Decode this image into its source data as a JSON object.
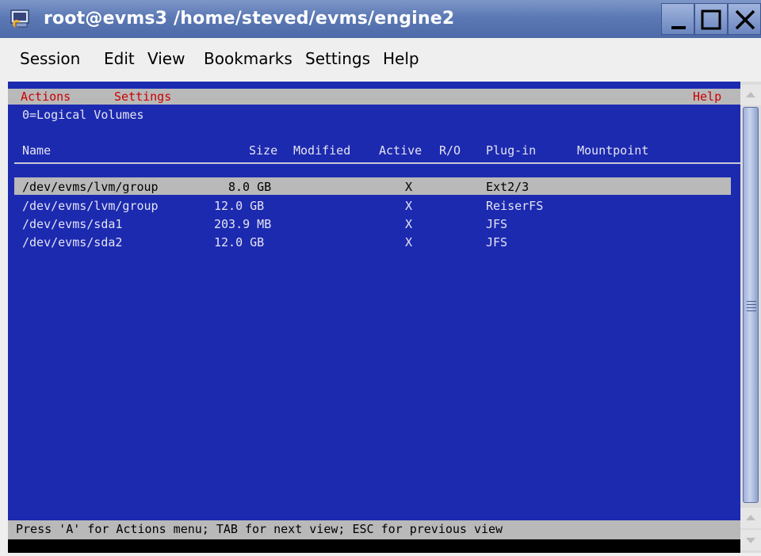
{
  "window": {
    "title": "root@evms3 /home/steved/evms/engine2"
  },
  "konsole_menu": [
    "Session",
    "Edit",
    "View",
    "Bookmarks",
    "Settings",
    "Help"
  ],
  "evms": {
    "menu": {
      "actions": "Actions",
      "settings": "Settings",
      "help": "Help"
    },
    "view_title": "0=Logical Volumes",
    "columns": {
      "name": "Name",
      "size": "Size",
      "modified": "Modified",
      "active": "Active",
      "ro": "R/O",
      "plugin": "Plug-in",
      "mountpoint": "Mountpoint"
    },
    "rows": [
      {
        "name": "/dev/evms/lvm/group",
        "size": "8.0 GB",
        "active": "X",
        "plugin": "Ext2/3"
      },
      {
        "name": "/dev/evms/lvm/group",
        "size": "12.0 GB",
        "active": "X",
        "plugin": "ReiserFS"
      },
      {
        "name": "/dev/evms/sda1",
        "size": "203.9 MB",
        "active": "X",
        "plugin": "JFS"
      },
      {
        "name": "/dev/evms/sda2",
        "size": "12.0 GB",
        "active": "X",
        "plugin": "JFS"
      }
    ],
    "status": "Press 'A' for Actions menu; TAB for next view; ESC for previous view"
  },
  "colors": {
    "terminal_bg": "#1c2ab0",
    "menu_highlight": "#cc0000",
    "selection": "#b9b9b9"
  }
}
